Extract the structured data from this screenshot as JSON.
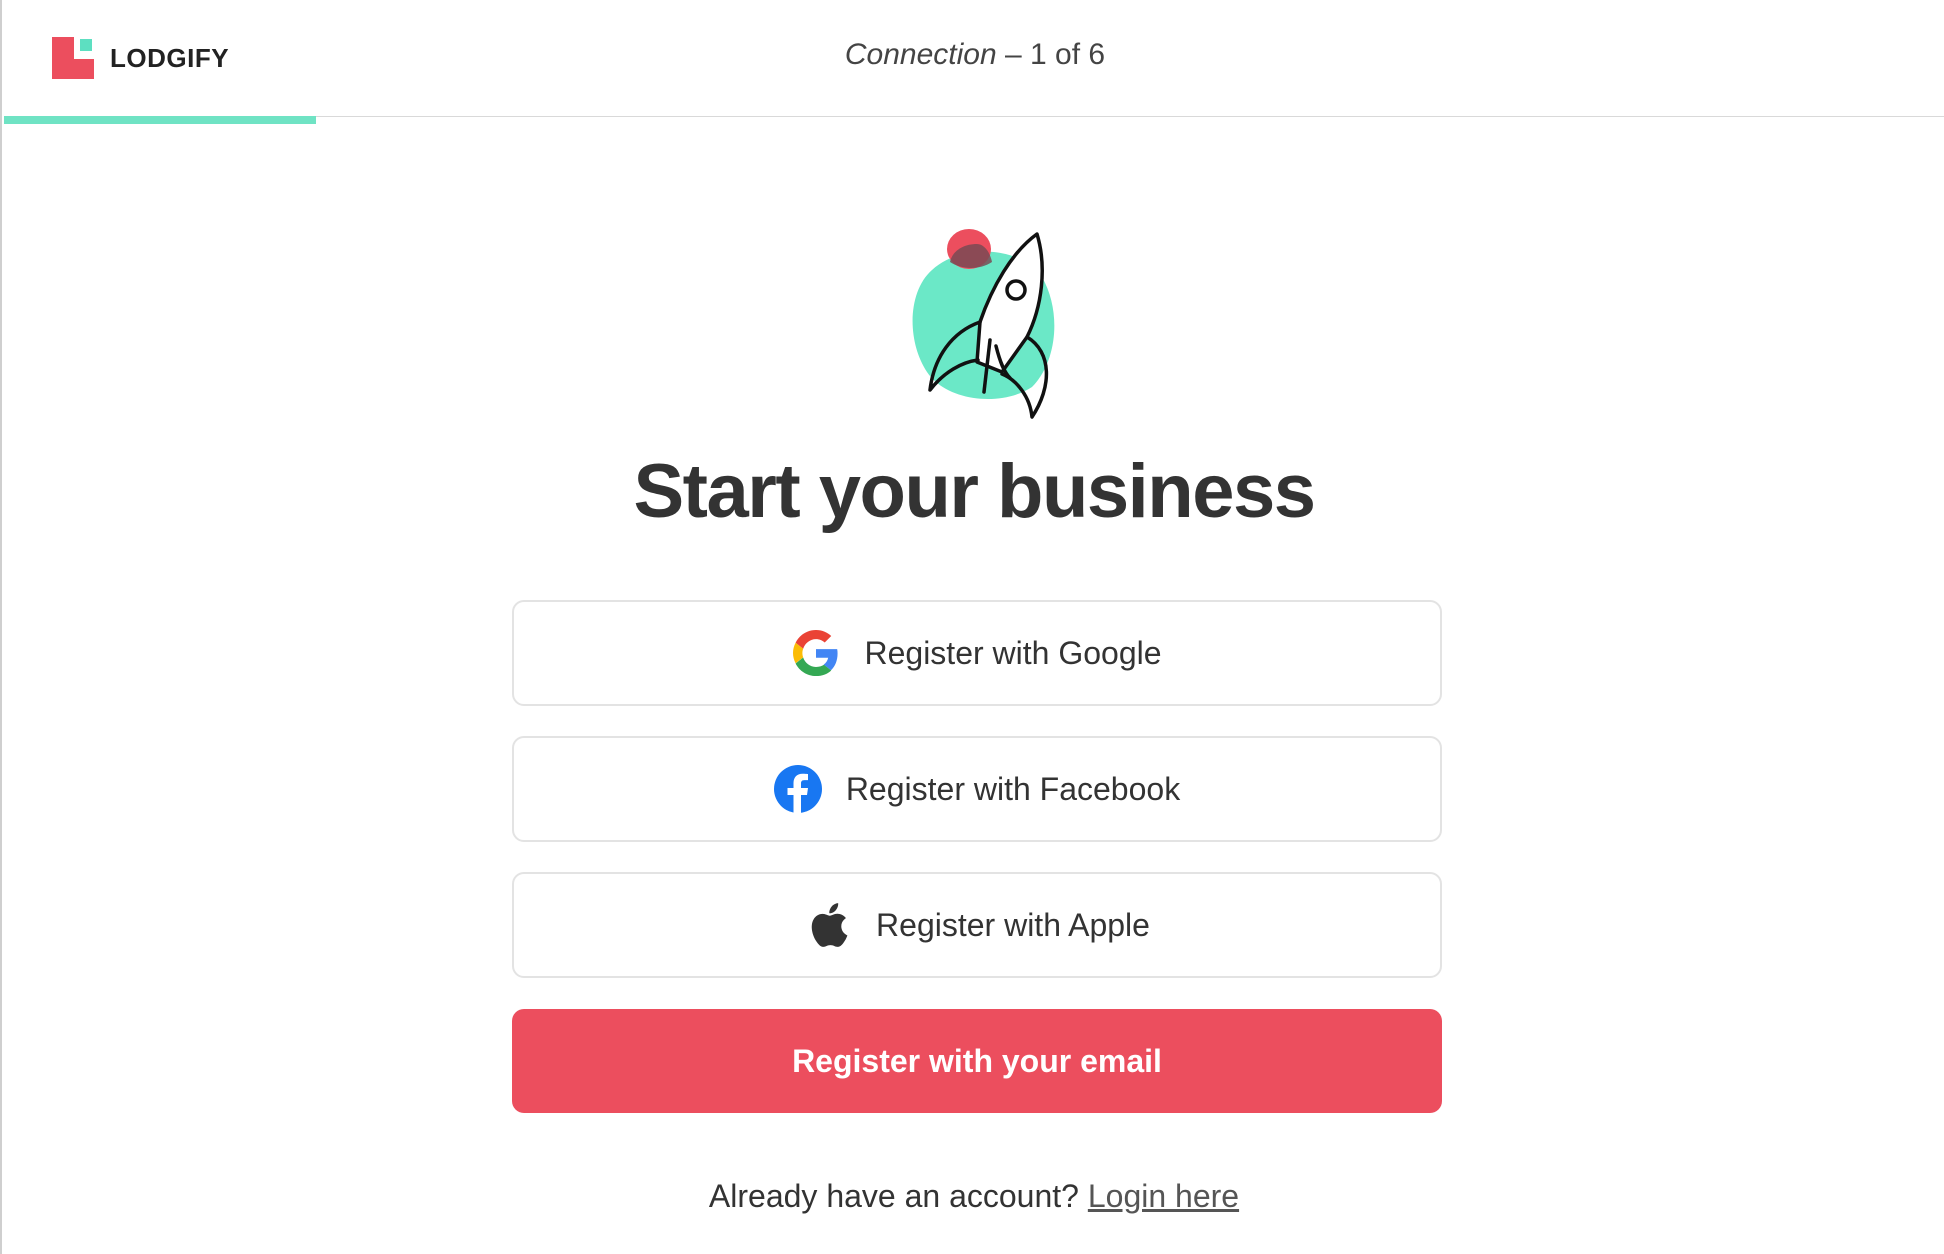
{
  "header": {
    "logo_text": "LODGIFY",
    "step_name": "Connection",
    "step_counter": "– 1 of 6",
    "progress_fraction": 0.1667
  },
  "hero": {
    "illustration": "rocket-icon",
    "title": "Start your business"
  },
  "buttons": {
    "google": {
      "label": "Register with Google",
      "icon": "google-icon"
    },
    "facebook": {
      "label": "Register with Facebook",
      "icon": "facebook-icon"
    },
    "apple": {
      "label": "Register with Apple",
      "icon": "apple-icon"
    },
    "email": {
      "label": "Register with your email"
    }
  },
  "footer": {
    "prompt": "Already have an account?",
    "login_link": "Login here"
  },
  "colors": {
    "brand_red": "#ec4e5e",
    "brand_teal": "#5ddfc1",
    "progress": "#6fe3c4",
    "facebook_blue": "#1877f2"
  }
}
